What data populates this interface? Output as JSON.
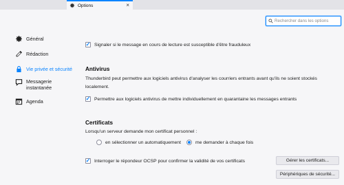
{
  "tab": {
    "title": "Options",
    "close_glyph": "×"
  },
  "sidebar": {
    "items": [
      {
        "label": "Général",
        "icon": "gear-icon"
      },
      {
        "label": "Rédaction",
        "icon": "pencil-icon"
      },
      {
        "label": "Vie privée et sécurité",
        "icon": "lock-icon",
        "active": true
      },
      {
        "label_line1": "Messagerie",
        "label_line2": "instantanée",
        "icon": "chat-icon"
      },
      {
        "label": "Agenda",
        "icon": "calendar-icon"
      }
    ]
  },
  "search": {
    "placeholder": "Rechercher dans les options",
    "value": ""
  },
  "main": {
    "fraud": {
      "label": "Signaler si le message en cours de lecture est susceptible d'être frauduleux",
      "checked": true
    },
    "antivirus": {
      "heading": "Antivirus",
      "description": "Thunderbird peut permettre aux logiciels antivirus d'analyser les courriers entrants avant qu'ils ne soient stockés localement.",
      "quarantine": {
        "label": "Permettre aux logiciels antivirus de mettre individuellement en quarantaine les messages entrants",
        "checked": true
      }
    },
    "certificates": {
      "heading": "Certificats",
      "question": "Lorsqu'un serveur demande mon certificat personnel :",
      "radio_auto": {
        "label": "en sélectionner un automatiquement",
        "selected": false
      },
      "radio_ask": {
        "label": "me demander à chaque fois",
        "selected": true
      },
      "ocsp": {
        "label": "Interroger le répondeur OCSP pour confirmer la validité de vos certificats",
        "checked": true
      },
      "manage_button": "Gérer les certificats...",
      "devices_button": "Périphériques de sécurité..."
    }
  },
  "colors": {
    "accent": "#0a84ff",
    "sidebar_bg": "#f6f6f8",
    "tabbar_bg": "#e3e3e7"
  }
}
